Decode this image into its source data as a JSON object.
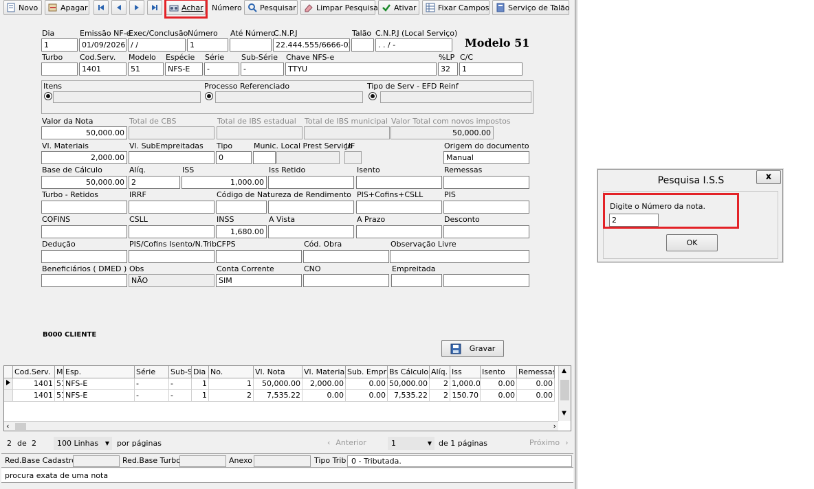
{
  "toolbar": {
    "novo": "Novo",
    "apagar": "Apagar",
    "achar": "Achar",
    "numero": "Número",
    "pesquisar": "Pesquisar",
    "limpar": "Limpar Pesquisa",
    "ativar": "Ativar",
    "fixar": "Fixar Campos",
    "servico": "Serviço de Talão"
  },
  "form": {
    "modelo_title": "Modelo 51",
    "labels": {
      "dia": "Dia",
      "emissao": "Emissão NF-e",
      "exec": "Exec/Conclusão",
      "numero": "Número",
      "ate_numero": "Até Número",
      "cnpj": "C.N.P.J",
      "talao": "Talão",
      "cnpj_local": "C.N.P.J (Local Serviço)",
      "turbo": "Turbo",
      "cod_serv": "Cod.Serv.",
      "modelo": "Modelo",
      "especie": "Espécie",
      "serie": "Série",
      "sub_serie": "Sub-Série",
      "chave": "Chave NFS-e",
      "lp": "%LP",
      "cc": "C/C",
      "itens": "Itens",
      "processo": "Processo Referenciado",
      "tipo_serv": "Tipo de Serv - EFD Reinf",
      "valor_nota": "Valor da Nota",
      "total_cbs": "Total de CBS",
      "total_ibs_est": "Total de IBS estadual",
      "total_ibs_mun": "Total de IBS municipal",
      "valor_total_novos": "Valor Total com novos impostos",
      "vl_materiais": "Vl. Materiais",
      "vl_sub": "Vl. SubEmpreitadas",
      "tipo": "Tipo",
      "munic": "Munic. Local Prest Serviço",
      "uf": "UF",
      "origem": "Origem do documento",
      "base_calculo": "Base de Cálculo",
      "aliq": "Alíq.",
      "iss": "ISS",
      "iss_retido": "Iss Retido",
      "isento": "Isento",
      "remessas": "Remessas",
      "turbo_retidos": "Turbo - Retidos",
      "irrf": "IRRF",
      "cod_natureza": "Código de Natureza de Rendimento",
      "pis_cofins_csll": "PIS+Cofins+CSLL",
      "pis": "PIS",
      "cofins": "COFINS",
      "csll": "CSLL",
      "inss": "INSS",
      "a_vista": "A Vista",
      "a_prazo": "A Prazo",
      "desconto": "Desconto",
      "deducao": "Dedução",
      "pis_cofins_isento": "PIS/Cofins Isento/N.Trib.",
      "cfps": "CFPS",
      "cod_obra": "Cód. Obra",
      "obs_livre": "Observação Livre",
      "beneficiarios": "Beneficiários ( DMED )",
      "obs": "Obs",
      "conta_corrente": "Conta Corrente",
      "cno": "CNO",
      "empreitada": "Empreitada"
    },
    "values": {
      "dia": "1",
      "emissao": "01/09/2026",
      "exec": "  /  /",
      "numero": "1",
      "ate_numero": "",
      "cnpj": "22.444.555/6666-02",
      "talao": "",
      "cnpj_local": "  .   .   /    -",
      "turbo": "",
      "cod_serv": "1401",
      "modelo": "51",
      "especie": "NFS-E",
      "serie": "-",
      "sub_serie": "-",
      "chave": "TTYU",
      "lp": "32",
      "cc": "1",
      "valor_nota": "50,000.00",
      "valor_total_novos": "50,000.00",
      "vl_materiais": "2,000.00",
      "tipo": "0",
      "origem": "Manual",
      "base_calculo": "50,000.00",
      "aliq": "2",
      "iss": "1,000.00",
      "inss": "1,680.00",
      "obs": "NÃO",
      "conta_corrente": "SIM"
    }
  },
  "client_label": "B000 CLIENTE",
  "gravar": "Gravar",
  "grid": {
    "headers": [
      "Cod.Serv.",
      "M.",
      "Esp.",
      "Série",
      "Sub-S",
      "Dia",
      "No.",
      "Vl. Nota",
      "Vl. Materiais",
      "Sub. Empr",
      "Bs Cálculo",
      "Alíq.",
      "Iss",
      "Isento",
      "Remessas"
    ],
    "rows": [
      [
        "1401",
        "51",
        "NFS-E",
        "-",
        "-",
        "1",
        "1",
        "50,000.00",
        "2,000.00",
        "0.00",
        "50,000.00",
        "2",
        "1,000.00",
        "0.00",
        "0.00"
      ],
      [
        "1401",
        "51",
        "NFS-E",
        "-",
        "-",
        "1",
        "2",
        "7,535.22",
        "0.00",
        "0.00",
        "7,535.22",
        "2",
        "150.70",
        "0.00",
        "0.00"
      ]
    ]
  },
  "pager": {
    "current": "2",
    "de": "de",
    "total": "2",
    "linhas": "100 Linhas",
    "por_paginas": "por páginas",
    "anterior": "Anterior",
    "page": "1",
    "de_paginas": "de 1 páginas",
    "proximo": "Próximo"
  },
  "status": {
    "red_base_cadastro": "Red.Base Cadastro",
    "red_base_turbo": "Red.Base Turbo",
    "anexo": "Anexo",
    "tipo_trib": "Tipo Trib",
    "tipo_trib_value": "0  - Tributada.",
    "message": "procura exata de uma nota"
  },
  "dialog": {
    "title": "Pesquisa I.S.S",
    "close": "x",
    "prompt": "Digite o Número da nota.",
    "value": "2",
    "ok": "OK"
  },
  "colors": {
    "highlight": "#e32227",
    "frame_bg": "#f0f0f0"
  }
}
